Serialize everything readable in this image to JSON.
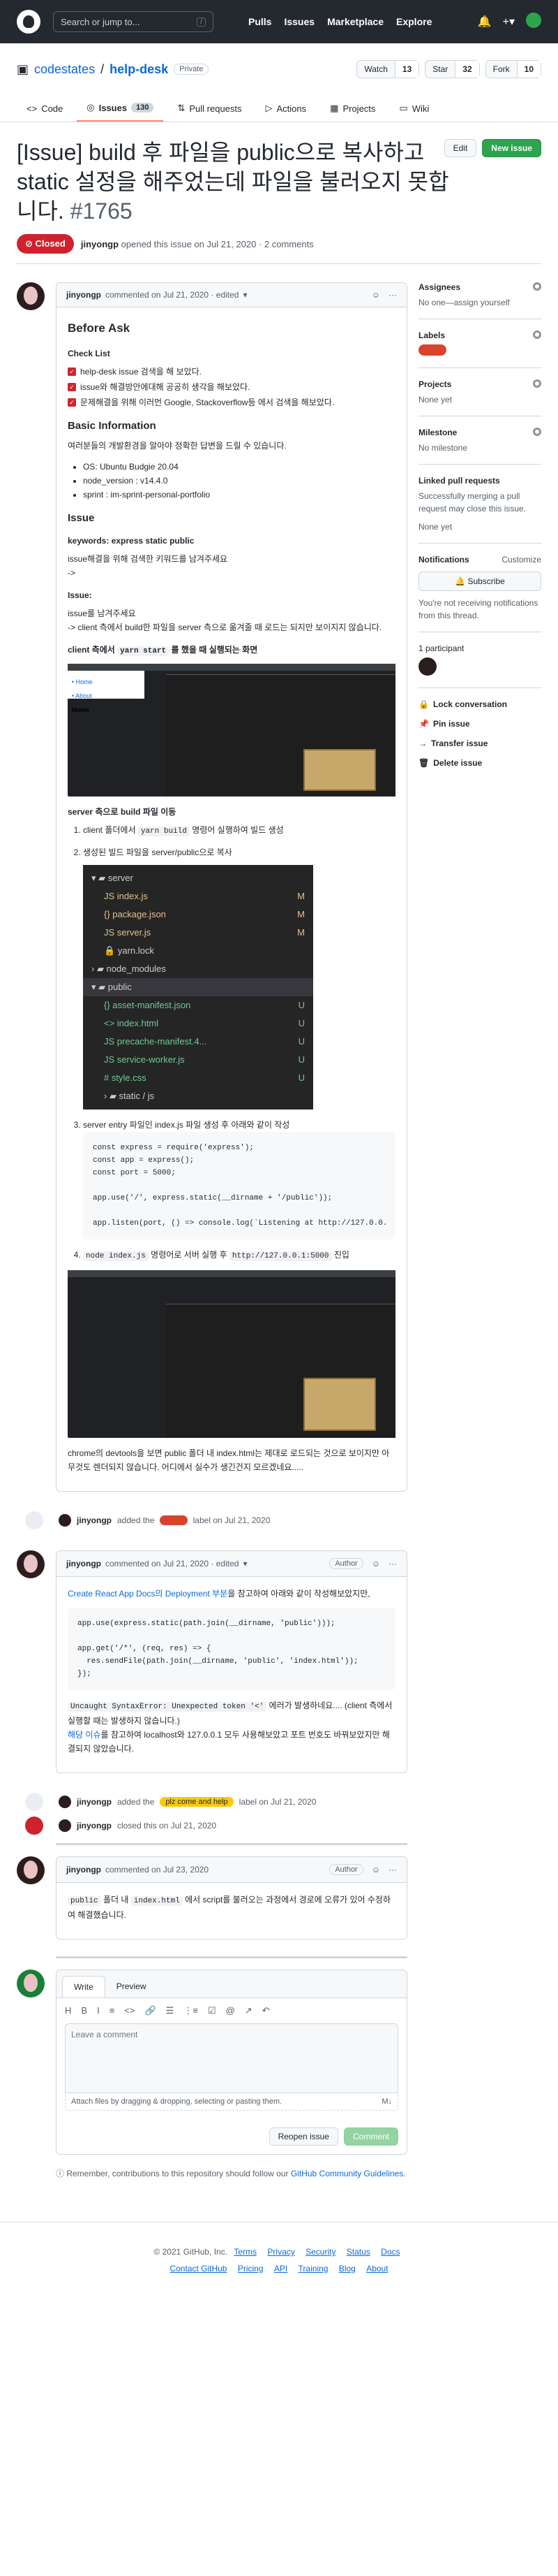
{
  "topbar": {
    "search_placeholder": "Search or jump to...",
    "search_kbd": "/",
    "nav": [
      "Pulls",
      "Issues",
      "Marketplace",
      "Explore"
    ]
  },
  "repo": {
    "owner": "codestates",
    "name": "help-desk",
    "visibility": "Private",
    "watch_label": "Watch",
    "watch_count": "13",
    "star_label": "Star",
    "star_count": "32",
    "fork_label": "Fork",
    "fork_count": "10",
    "tabs": [
      {
        "label": "Code"
      },
      {
        "label": "Issues",
        "count": "130"
      },
      {
        "label": "Pull requests"
      },
      {
        "label": "Actions"
      },
      {
        "label": "Projects"
      },
      {
        "label": "Wiki"
      }
    ]
  },
  "issue": {
    "title": "[Issue] build 후 파일을 public으로 복사하고 static 설정을 해주었는데 파일을 불러오지 못합니다.",
    "number": "#1765",
    "edit_label": "Edit",
    "new_issue_label": "New issue",
    "state": "Closed",
    "author": "jinyongp",
    "opened_text": "opened this issue on Jul 21, 2020 · 2 comments"
  },
  "comment1": {
    "author": "jinyongp",
    "meta": "commented on Jul 21, 2020 · edited",
    "h_before": "Before Ask",
    "h_checklist": "Check List",
    "checklist": [
      "help-desk issue 검색을 해 보았다.",
      "issue와 해결방안에대해 공공히 생각을 해보았다.",
      "문제해결을 위해 이러먼 Google, Stackoverflow등 에서 검색을 해보았다."
    ],
    "h_basic": "Basic Information",
    "basic_intro": "여러분들의 개발환경을 알아야 정확한 답변을 드릴 수 있습니다.",
    "basic_list": [
      "OS: Ubuntu Budgie 20.04",
      "node_version : v14.4.0",
      "sprint : im-sprint-personal-portfolio"
    ],
    "h_issue": "Issue",
    "keywords": "keywords: express static public",
    "keywords_desc": "issue해결을 위해 검색한 키워드를 남겨주세요",
    "arrow": "->",
    "issue_label": "Issue:",
    "issue_desc1": "issue를 남겨주세요",
    "issue_desc2": "-> client 측에서 build한 파일을 server 측으로 옮겨줄 때 로드는 되지만 보이지지 않습니다.",
    "client_caption_pre": "client 측에서",
    "client_caption_code": "yarn start",
    "client_caption_post": "를 했을 때 실행되는 화면",
    "shot_home": "Home",
    "server_caption": "server 측으로 build 파일 이동",
    "step1_pre": "client 폴더에서",
    "step1_code": "yarn build",
    "step1_post": "명령어 실행하여 빌드 생성",
    "step2": "생성된 빌드 파일을 server/public으로 복사",
    "tree": [
      {
        "name": "server",
        "status": "",
        "kind": "folder",
        "indent": 0
      },
      {
        "name": "index.js",
        "status": "M",
        "kind": "js",
        "indent": 1
      },
      {
        "name": "package.json",
        "status": "M",
        "kind": "json",
        "indent": 1
      },
      {
        "name": "server.js",
        "status": "M",
        "kind": "js",
        "indent": 1
      },
      {
        "name": "yarn.lock",
        "status": "",
        "kind": "lock",
        "indent": 1
      },
      {
        "name": "node_modules",
        "status": "",
        "kind": "folder-c",
        "indent": 0
      },
      {
        "name": "public",
        "status": "",
        "kind": "folder-o",
        "indent": 0
      },
      {
        "name": "asset-manifest.json",
        "status": "U",
        "kind": "json",
        "indent": 1
      },
      {
        "name": "index.html",
        "status": "U",
        "kind": "html",
        "indent": 1
      },
      {
        "name": "precache-manifest.4...",
        "status": "U",
        "kind": "js",
        "indent": 1
      },
      {
        "name": "service-worker.js",
        "status": "U",
        "kind": "js",
        "indent": 1
      },
      {
        "name": "style.css",
        "status": "U",
        "kind": "css",
        "indent": 1
      },
      {
        "name": "static / js",
        "status": "",
        "kind": "folder-c",
        "indent": 1
      }
    ],
    "step3": "server entry 파일인 index.js 파일 생성 후 아래와 같이 작성",
    "code1": [
      "const express = require('express');",
      "const app = express();",
      "const port = 5000;",
      "",
      "app.use('/', express.static(__dirname + '/public'));",
      "",
      "app.listen(port, () => console.log(`Listening at http://127.0.0."
    ],
    "step4_code1": "node index.js",
    "step4_mid": "명령어로 서버 실행 후",
    "step4_code2": "http://127.0.0.1:5000",
    "step4_post": "진입",
    "final": "chrome의 devtools을 보면 public 폴더 내 index.html는 제대로 로드되는 것으로 보이지만 아무것도 렌더되지 않습니다. 어디에서 실수가 생긴건지 모르겠네요....."
  },
  "event1": {
    "author": "jinyongp",
    "pre": "added the",
    "post": "label on Jul 21, 2020"
  },
  "comment2": {
    "author": "jinyongp",
    "meta": "commented on Jul 21, 2020 · edited",
    "badge": "Author",
    "intro_link": "Create React App Docs의 Deployment 부분",
    "intro_rest": "을 참고하여 아래와 같이 작성해보았지만,",
    "code": [
      "app.use(express.static(path.join(__dirname, 'public')));",
      "",
      "app.get('/*', (req, res) => {",
      "  res.sendFile(path.join(__dirname, 'public', 'index.html'));",
      "});"
    ],
    "err_code": "Uncaught SyntaxError: Unexpected token '<'",
    "err_text": "에러가 발생하네요.... (client 측에서 실행할 때는 발생하지 않습니다.)",
    "link2": "해당 이슈",
    "rest2": "를 참고하여 localhost와 127.0.0.1 모두 사용해보았고 포트 번호도 바꿔보았지만 해결되지 않았습니다."
  },
  "event2": {
    "author": "jinyongp",
    "pre": "added the",
    "label": "plz come and help",
    "post": "label on Jul 21, 2020"
  },
  "event3": {
    "author": "jinyongp",
    "text": "closed this on Jul 21, 2020"
  },
  "comment3": {
    "author": "jinyongp",
    "meta": "commented on Jul 23, 2020",
    "badge": "Author",
    "code1": "public",
    "mid1": "폴더 내",
    "code2": "index.html",
    "rest": "에서 script를 불러오는 과정에서 경로에 오류가 있어 수정하여 해결했습니다."
  },
  "editor": {
    "tab_write": "Write",
    "tab_preview": "Preview",
    "tools": [
      "H",
      "B",
      "I",
      "≡",
      "<>",
      "🔗",
      "☰",
      "⋮≡",
      "☑",
      "@",
      "↗",
      "↶"
    ],
    "placeholder": "Leave a comment",
    "attach": "Attach files by dragging & dropping, selecting or pasting them.",
    "md_icon": "M↓",
    "reopen": "Reopen issue",
    "comment": "Comment",
    "remember_pre": "Remember, contributions to this repository should follow our",
    "remember_link": "GitHub Community Guidelines",
    "remember_post": "."
  },
  "sidebar": {
    "assignees_h": "Assignees",
    "assignees_v": "No one—assign yourself",
    "labels_h": "Labels",
    "projects_h": "Projects",
    "projects_v": "None yet",
    "milestone_h": "Milestone",
    "milestone_v": "No milestone",
    "linked_h": "Linked pull requests",
    "linked_desc": "Successfully merging a pull request may close this issue.",
    "linked_v": "None yet",
    "notif_h": "Notifications",
    "notif_customize": "Customize",
    "subscribe": "Subscribe",
    "notif_desc": "You're not receiving notifications from this thread.",
    "participants": "1 participant",
    "actions": [
      "Lock conversation",
      "Pin issue",
      "Transfer issue",
      "Delete issue"
    ]
  },
  "footer": {
    "row1": [
      "© 2021 GitHub, Inc.",
      "Terms",
      "Privacy",
      "Security",
      "Status",
      "Docs"
    ],
    "row2": [
      "Contact GitHub",
      "Pricing",
      "API",
      "Training",
      "Blog",
      "About"
    ]
  },
  "colors": {
    "topbar": "#24292f",
    "closed": "#cf222e",
    "green": "#2da44e",
    "label_red": "#d9432c",
    "label_yellow": "#fbca04"
  }
}
